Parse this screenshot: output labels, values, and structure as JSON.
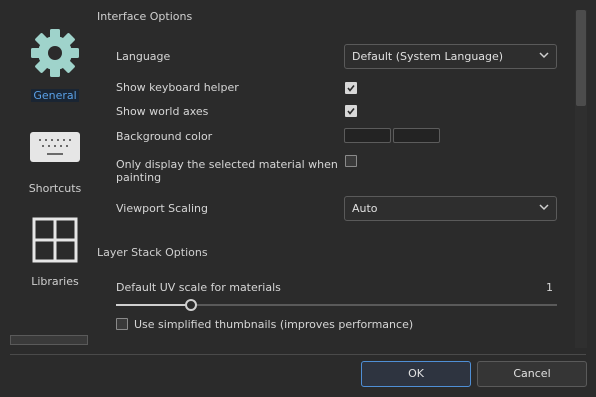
{
  "nav": {
    "general_label": "General",
    "shortcuts_label": "Shortcuts",
    "libraries_label": "Libraries"
  },
  "interface": {
    "title": "Interface Options",
    "language_label": "Language",
    "language_value": "Default (System Language)",
    "keyboard_helper_label": "Show keyboard helper",
    "keyboard_helper_checked": true,
    "world_axes_label": "Show world axes",
    "world_axes_checked": true,
    "background_color_label": "Background color",
    "only_selected_label_line1": "Only display the selected material when",
    "only_selected_label_line2": "painting",
    "only_selected_checked": false,
    "viewport_scaling_label": "Viewport Scaling",
    "viewport_scaling_value": "Auto"
  },
  "layer_stack": {
    "title": "Layer Stack Options",
    "uv_scale_label": "Default UV scale for materials",
    "uv_scale_value": "1",
    "uv_scale_fraction": 0.17,
    "simplified_thumbnails_label": "Use simplified thumbnails (improves performance)",
    "simplified_thumbnails_checked": false
  },
  "buttons": {
    "ok": "OK",
    "cancel": "Cancel"
  },
  "colors": {
    "accent": "#5aa0e6",
    "background": "#2b2b2b",
    "gear": "#9fd3cb"
  },
  "icons": [
    "gear-icon",
    "keyboard-icon",
    "grid-icon",
    "checkmark-icon",
    "chevron-down-icon"
  ]
}
